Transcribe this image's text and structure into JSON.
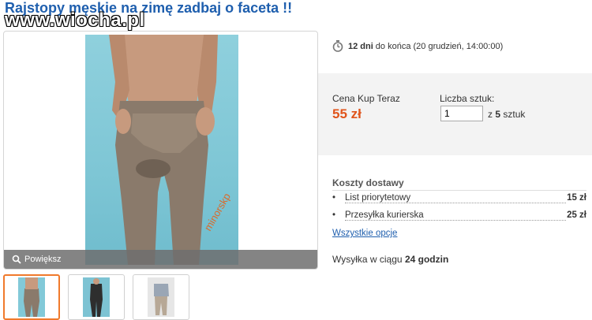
{
  "title": "Rajstopy męskie na zimę zadbaj o faceta !!",
  "watermark": "www.wiocha.pl",
  "gallery": {
    "zoom_label": "Powiększ",
    "photo_caption": "minorskp",
    "thumbnails": [
      {
        "name": "thumb-1",
        "active": true
      },
      {
        "name": "thumb-2",
        "active": false
      },
      {
        "name": "thumb-3",
        "active": false
      }
    ]
  },
  "timer": {
    "days": "12 dni",
    "until": "do końca",
    "end_date": "(20 grudzień, 14:00:00)"
  },
  "price": {
    "label": "Cena Kup Teraz",
    "value": "55 zł"
  },
  "quantity": {
    "label": "Liczba sztuk:",
    "value": "1",
    "of_prefix": "z",
    "max": "5",
    "unit": "sztuk"
  },
  "shipping": {
    "title": "Koszty dostawy",
    "bullet": "•",
    "options": [
      {
        "name": "List priorytetowy",
        "cost": "15 zł"
      },
      {
        "name": "Przesyłka kurierska",
        "cost": "25 zł"
      }
    ],
    "all_link": "Wszystkie opcje"
  },
  "dispatch": {
    "prefix": "Wysyłka w ciągu",
    "time": "24 godzin"
  },
  "colors": {
    "title": "#1f5fae",
    "price": "#e0541b",
    "accent": "#f07a2c"
  }
}
